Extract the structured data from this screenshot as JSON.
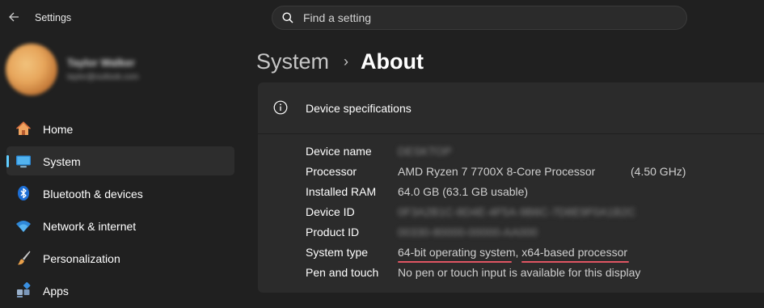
{
  "app": {
    "title": "Settings"
  },
  "search": {
    "placeholder": "Find a setting"
  },
  "profile": {
    "name": "Taylor Walker",
    "email": "taylor@outlook.com"
  },
  "nav": {
    "items": [
      {
        "label": "Home",
        "icon": "home-icon"
      },
      {
        "label": "System",
        "icon": "system-display-icon",
        "active": true
      },
      {
        "label": "Bluetooth & devices",
        "icon": "bluetooth-icon"
      },
      {
        "label": "Network & internet",
        "icon": "wifi-icon"
      },
      {
        "label": "Personalization",
        "icon": "paintbrush-icon"
      },
      {
        "label": "Apps",
        "icon": "apps-icon"
      }
    ]
  },
  "breadcrumb": {
    "parent": "System",
    "separator": "›",
    "current": "About"
  },
  "device_specs": {
    "title": "Device specifications",
    "rows": [
      {
        "label": "Device name",
        "value": "DESKTOP"
      },
      {
        "label": "Processor",
        "value": "AMD Ryzen 7 7700X 8-Core Processor",
        "extra": "(4.50 GHz)"
      },
      {
        "label": "Installed RAM",
        "value": "64.0 GB (63.1 GB usable)"
      },
      {
        "label": "Device ID",
        "value": "0F3A2B1C-8D4E-4F5A-9B6C-7D8E9F0A1B2C"
      },
      {
        "label": "Product ID",
        "value": "00330-80000-00000-AA000"
      },
      {
        "label": "System type",
        "value": "64-bit operating system, x64-based processor"
      },
      {
        "label": "Pen and touch",
        "value": "No pen or touch input is available for this display"
      }
    ]
  },
  "colors": {
    "accent": "#60cdff",
    "highlight_underline": "#e05563",
    "card": "#2b2b2b",
    "background": "#202020"
  }
}
